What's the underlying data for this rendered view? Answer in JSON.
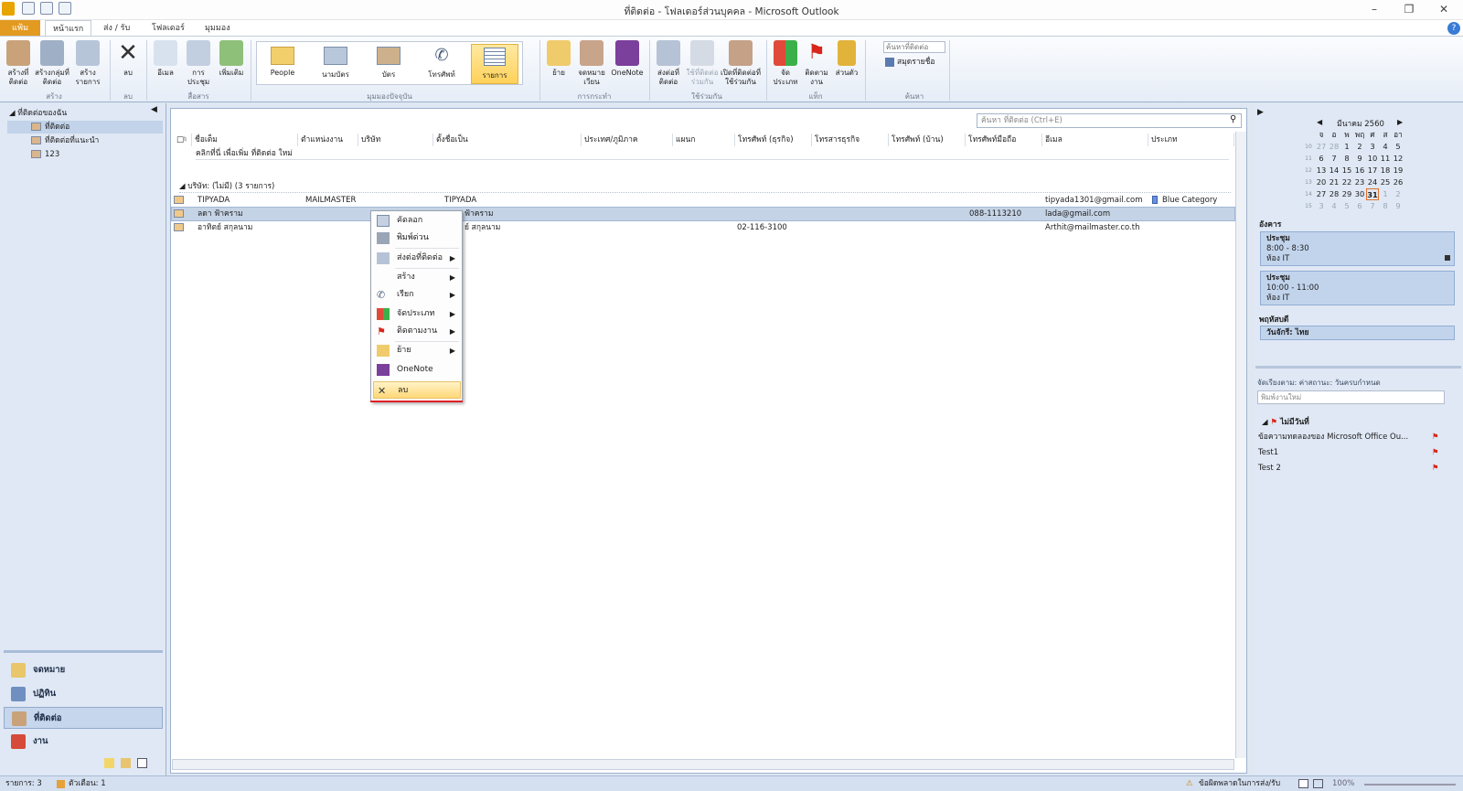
{
  "window": {
    "title": "ที่ติดต่อ - โฟลเดอร์ส่วนบุคคล - Microsoft Outlook"
  },
  "tabs": [
    "แฟ้ม",
    "หน้าแรก",
    "ส่ง / รับ",
    "โฟลเดอร์",
    "มุมมอง"
  ],
  "ribbon": {
    "new_contact": "สร้างที่ติดต่อ",
    "new_group": "สร้างกลุ่มที่ติดต่อ",
    "new_items": "สร้างรายการ",
    "group_new": "สร้าง",
    "delete": "ลบ",
    "group_delete": "ลบ",
    "email": "อีเมล",
    "meeting": "การประชุม",
    "more": "เพิ่มเติม",
    "group_comm": "สื่อสาร",
    "views": [
      "People",
      "นามบัตร",
      "บัตร",
      "โทรศัพท์",
      "รายการ"
    ],
    "group_views": "มุมมองปัจจุบัน",
    "move": "ย้าย",
    "mail_merge": "จดหมายเวียน",
    "onenote": "OneNote",
    "group_actions": "การกระทำ",
    "forward_contact": "ส่งต่อที่ติดต่อ",
    "share_contacts": "ใช้ที่ติดต่อร่วมกัน",
    "open_shared": "เปิดที่ติดต่อที่ใช้ร่วมกัน",
    "group_share": "ใช้ร่วมกัน",
    "categorize": "จัดประเภท",
    "followup": "ติดตามงาน",
    "private": "ส่วนตัว",
    "group_tags": "แท็ก",
    "search_contacts": "ค้นหาที่ติดต่อ",
    "address_book": "สมุดรายชื่อ",
    "group_find": "ค้นหา"
  },
  "nav": {
    "tree_header": "ที่ติดต่อของฉัน",
    "tree_items": [
      "ที่ติดต่อ",
      "ที่ติดต่อที่แนะนำ",
      "123"
    ],
    "buttons": [
      "จดหมาย",
      "ปฏิทิน",
      "ที่ติดต่อ",
      "งาน"
    ]
  },
  "search": {
    "placeholder": "ค้นหา ที่ติดต่อ (Ctrl+E)"
  },
  "columns": [
    "ชื่อเต็ม",
    "ตำแหน่งงาน",
    "บริษัท",
    "ตั้งชื่อเป็น",
    "ประเทศ/ภูมิภาค",
    "แผนก",
    "โทรศัพท์ (ธุรกิจ)",
    "โทรสารธุรกิจ",
    "โทรศัพท์ (บ้าน)",
    "โทรศัพท์มือถือ",
    "อีเมล",
    "ประเภท"
  ],
  "new_row_hint": "คลิกที่นี่ เพื่อเพิ่ม ที่ติดต่อ ใหม่",
  "group_header": "บริษัท: (ไม่มี) (3 รายการ)",
  "contacts": [
    {
      "name": "TIPYADA",
      "job": "MAILMASTER",
      "company": "",
      "file_as": "TIPYADA",
      "phone_business": "",
      "mobile": "",
      "email": "tipyada1301@gmail.com",
      "category": "Blue Category"
    },
    {
      "name": "ลดา ฟ้าคราม",
      "job": "",
      "company": "",
      "file_as": "ฟ้าคราม",
      "phone_business": "",
      "mobile": "088-1113210",
      "email": "lada@gmail.com",
      "category": ""
    },
    {
      "name": "อาทิตย์ สกุลนาม",
      "job": "",
      "company": "",
      "file_as": "ย์ สกุลนาม",
      "phone_business": "02-116-3100",
      "mobile": "",
      "email": "Arthit@mailmaster.co.th",
      "category": ""
    }
  ],
  "context_menu": [
    "คัดลอก",
    "พิมพ์ด่วน",
    "ส่งต่อที่ติดต่อ",
    "สร้าง",
    "เรียก",
    "จัดประเภท",
    "ติดตามงาน",
    "ย้าย",
    "OneNote",
    "ลบ"
  ],
  "calendar": {
    "month": "มีนาคม 2560",
    "weekdays": [
      "จ",
      "อ",
      "พ",
      "พฤ",
      "ศ",
      "ส",
      "อา"
    ],
    "weeks": [
      {
        "wk": "10",
        "days": [
          "27",
          "28",
          "1",
          "2",
          "3",
          "4",
          "5"
        ]
      },
      {
        "wk": "11",
        "days": [
          "6",
          "7",
          "8",
          "9",
          "10",
          "11",
          "12"
        ]
      },
      {
        "wk": "12",
        "days": [
          "13",
          "14",
          "15",
          "16",
          "17",
          "18",
          "19"
        ]
      },
      {
        "wk": "13",
        "days": [
          "20",
          "21",
          "22",
          "23",
          "24",
          "25",
          "26"
        ]
      },
      {
        "wk": "14",
        "days": [
          "27",
          "28",
          "29",
          "30",
          "31",
          "1",
          "2"
        ]
      },
      {
        "wk": "15",
        "days": [
          "3",
          "4",
          "5",
          "6",
          "7",
          "8",
          "9"
        ]
      }
    ]
  },
  "agenda": {
    "day1": "อังคาร",
    "appt1": {
      "title": "ประชุม",
      "time": "8:00 - 8:30",
      "place": "ห้อง IT"
    },
    "appt2": {
      "title": "ประชุม",
      "time": "10:00 - 11:00",
      "place": "ห้อง IT"
    },
    "day2": "พฤหัสบดี",
    "appt3": "วันจักรี: ไทย"
  },
  "tasks": {
    "arrange": "จัดเรียงตาม: ค่าสถานะ: วันครบกำหนด",
    "new_placeholder": "พิมพ์งานใหม่",
    "group": "ไม่มีวันที่",
    "items": [
      "ข้อความทดลองของ Microsoft Office Ou...",
      "Test1",
      "Test 2"
    ]
  },
  "status": {
    "items": "รายการ: 3",
    "reminders": "ตัวเตือน: 1",
    "error": "ข้อผิดพลาดในการส่ง/รับ",
    "zoom": "100%"
  }
}
